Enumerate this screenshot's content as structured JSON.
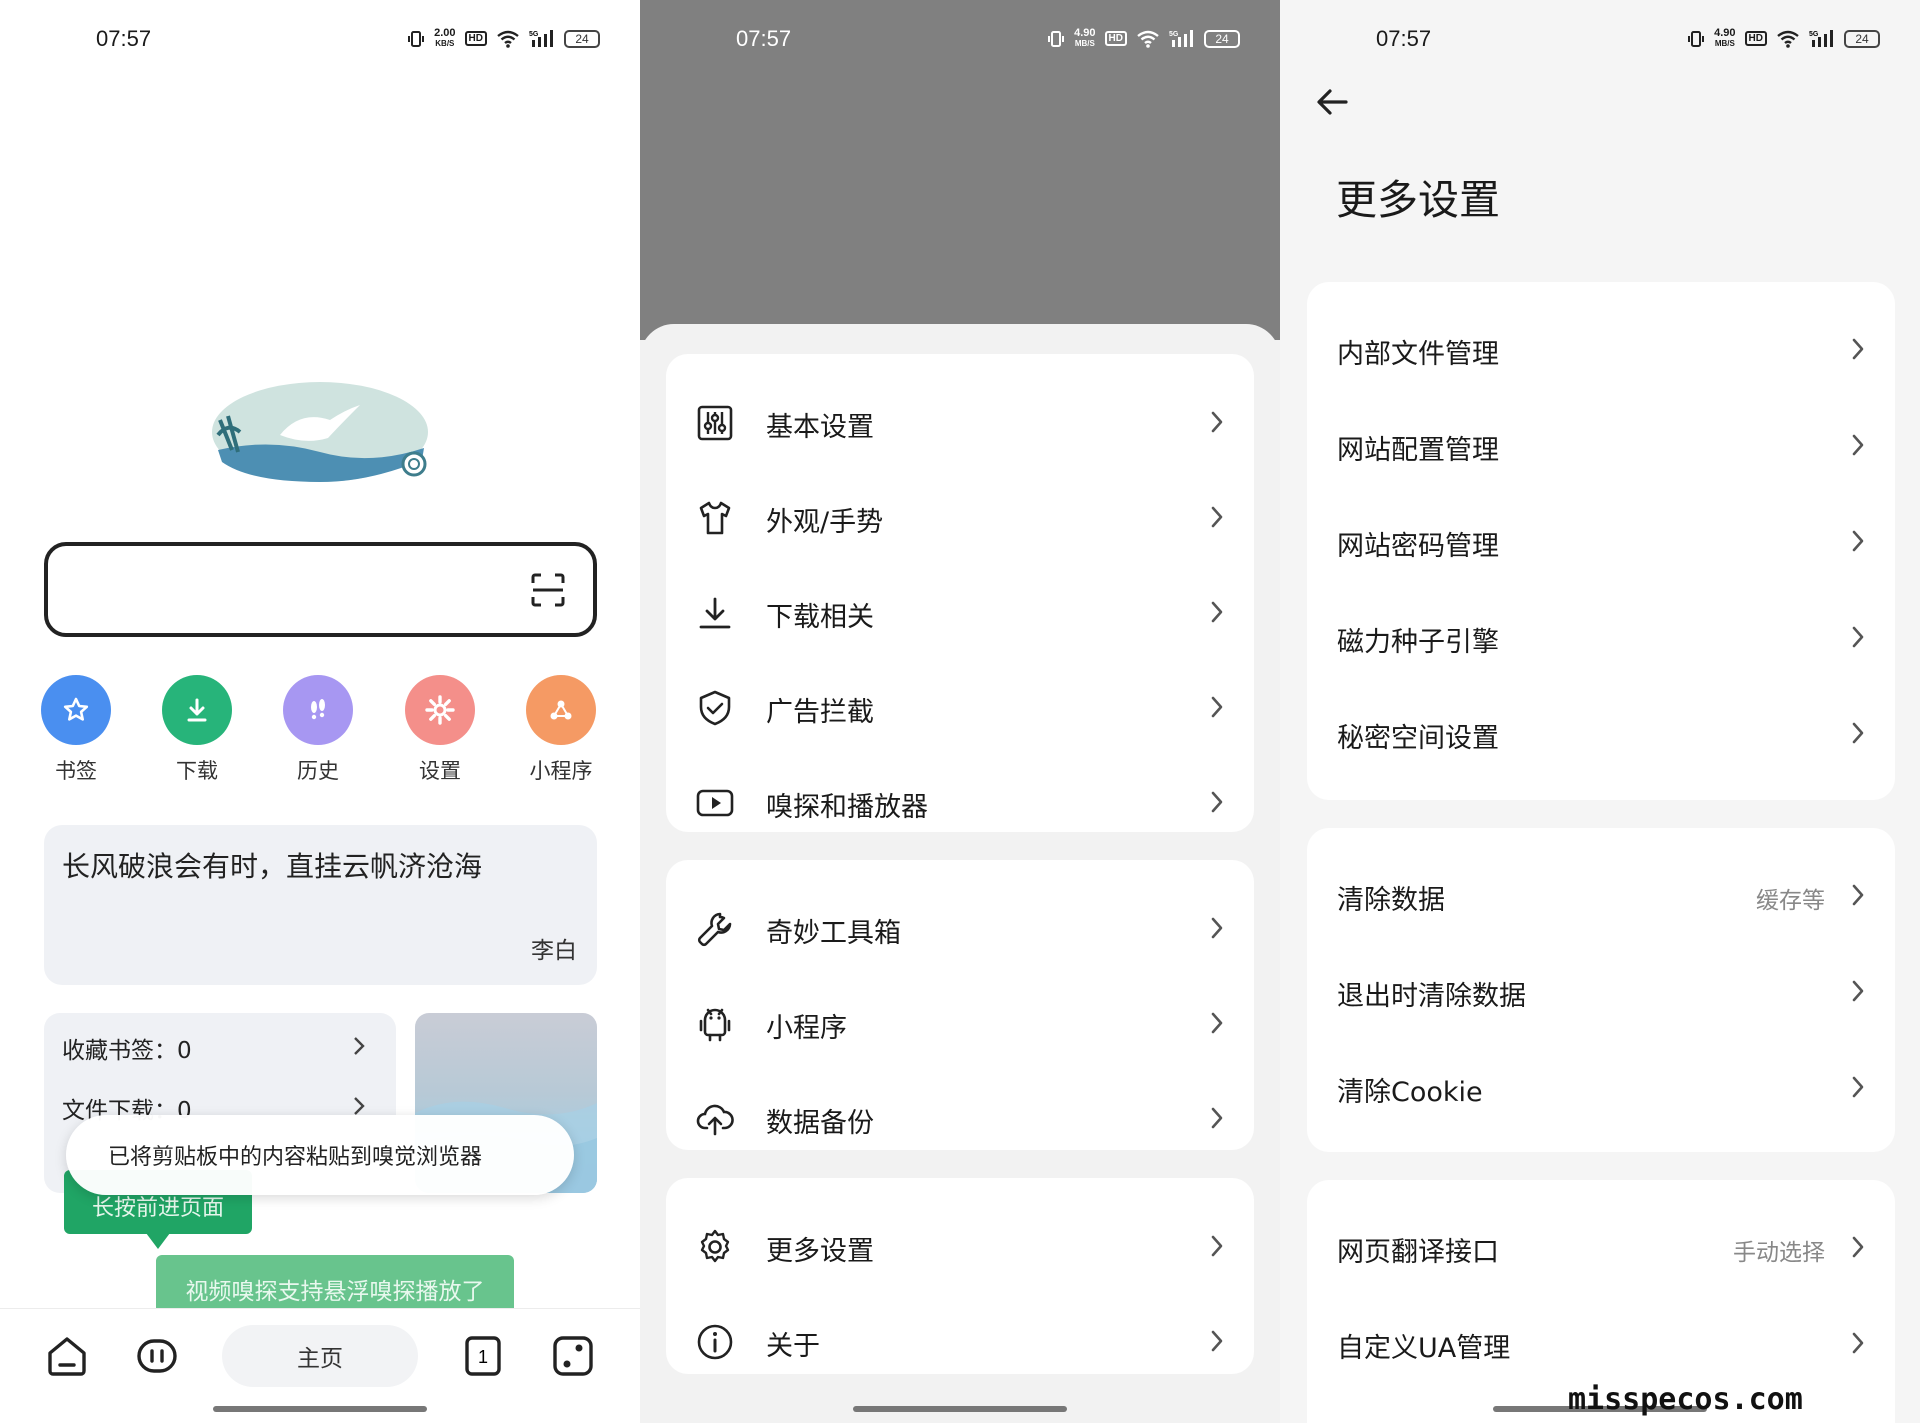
{
  "status_bar": {
    "time": "07:57",
    "p1_speed": [
      "2.00",
      "KB/S"
    ],
    "p2_speed": [
      "4.90",
      "MB/S"
    ],
    "p3_speed": [
      "4.90",
      "MB/S"
    ],
    "hd": "HD",
    "net": "5G",
    "battery": "24"
  },
  "home": {
    "quick_links": [
      {
        "label": "书签",
        "color": "#4a8ff0",
        "icon": "star-icon"
      },
      {
        "label": "下载",
        "color": "#27b47a",
        "icon": "download-icon"
      },
      {
        "label": "历史",
        "color": "#a797f2",
        "icon": "footprint-icon"
      },
      {
        "label": "设置",
        "color": "#f48f8a",
        "icon": "gear-icon"
      },
      {
        "label": "小程序",
        "color": "#f59a64",
        "icon": "share-icon"
      }
    ],
    "poem": "长风破浪会有时，直挂云帆济沧海",
    "author": "李白",
    "stats": [
      {
        "label": "收藏书签：0"
      },
      {
        "label": "文件下载：0"
      }
    ],
    "toast": "已将剪贴板中的内容粘贴到嗅觉浏览器",
    "tip_forward": "长按前进页面",
    "tip_video": "视频嗅探支持悬浮嗅探播放了",
    "nav_home": "主页",
    "tab_count": "1"
  },
  "menu": {
    "groups": [
      [
        {
          "label": "基本设置",
          "icon": "sliders-icon"
        },
        {
          "label": "外观/手势",
          "icon": "shirt-icon"
        },
        {
          "label": "下载相关",
          "icon": "download-icon"
        },
        {
          "label": "广告拦截",
          "icon": "shield-icon"
        },
        {
          "label": "嗅探和播放器",
          "icon": "play-icon"
        }
      ],
      [
        {
          "label": "奇妙工具箱",
          "icon": "wrench-icon"
        },
        {
          "label": "小程序",
          "icon": "android-icon"
        },
        {
          "label": "数据备份",
          "icon": "cloud-upload-icon"
        }
      ],
      [
        {
          "label": "更多设置",
          "icon": "gear-icon"
        },
        {
          "label": "关于",
          "icon": "info-icon"
        }
      ]
    ]
  },
  "more_settings": {
    "title": "更多设置",
    "groups": [
      [
        {
          "label": "内部文件管理",
          "value": ""
        },
        {
          "label": "网站配置管理",
          "value": ""
        },
        {
          "label": "网站密码管理",
          "value": ""
        },
        {
          "label": "磁力种子引擎",
          "value": ""
        },
        {
          "label": "秘密空间设置",
          "value": ""
        }
      ],
      [
        {
          "label": "清除数据",
          "value": "缓存等"
        },
        {
          "label": "退出时清除数据",
          "value": ""
        },
        {
          "label": "清除Cookie",
          "value": ""
        }
      ],
      [
        {
          "label": "网页翻译接口",
          "value": "手动选择"
        },
        {
          "label": "自定义UA管理",
          "value": ""
        }
      ]
    ],
    "watermark": "misspecos.com"
  }
}
